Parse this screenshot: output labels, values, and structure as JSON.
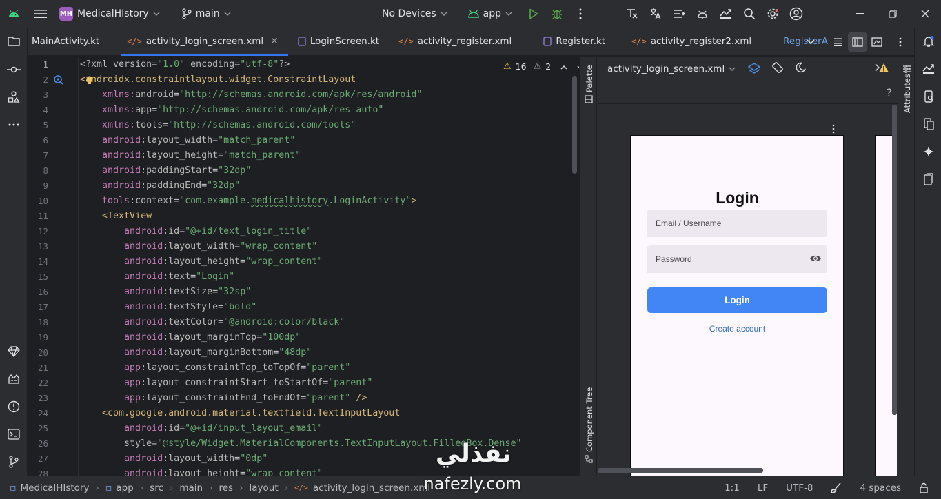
{
  "titlebar": {
    "project_badge": "MH",
    "project_name": "MedicalHIstory",
    "branch": "main",
    "device": "No Devices",
    "run_config": "app"
  },
  "tabs": [
    {
      "label": "MainActivity.kt",
      "active": false
    },
    {
      "label": "activity_login_screen.xml",
      "active": true
    },
    {
      "label": "LoginScreen.kt",
      "active": false
    },
    {
      "label": "activity_register.xml",
      "active": false
    },
    {
      "label": "Register.kt",
      "active": false
    },
    {
      "label": "activity_register2.xml",
      "active": false
    },
    {
      "label": "RegisterA",
      "active": false
    }
  ],
  "inspections": {
    "warnings": "16",
    "weak_warnings": "2"
  },
  "code_lines": [
    [
      [
        "pi",
        "<?xml "
      ],
      [
        "attr",
        "version"
      ],
      [
        "pun",
        "="
      ],
      [
        "str",
        "\"1.0\""
      ],
      [
        "attr",
        " encoding"
      ],
      [
        "pun",
        "="
      ],
      [
        "str",
        "\"utf-8\""
      ],
      [
        "pi",
        "?>"
      ]
    ],
    [
      [
        "tag",
        "<androidx.constraintlayout.widget.ConstraintLayout"
      ]
    ],
    [
      [
        "pun",
        "    "
      ],
      [
        "ns",
        "xmlns:"
      ],
      [
        "attr",
        "android"
      ],
      [
        "pun",
        "="
      ],
      [
        "str",
        "\"http://schemas.android.com/apk/res/android\""
      ]
    ],
    [
      [
        "pun",
        "    "
      ],
      [
        "ns",
        "xmlns:"
      ],
      [
        "attr",
        "app"
      ],
      [
        "pun",
        "="
      ],
      [
        "str",
        "\"http://schemas.android.com/apk/res-auto\""
      ]
    ],
    [
      [
        "pun",
        "    "
      ],
      [
        "ns",
        "xmlns:"
      ],
      [
        "attr",
        "tools"
      ],
      [
        "pun",
        "="
      ],
      [
        "str",
        "\"http://schemas.android.com/tools\""
      ]
    ],
    [
      [
        "pun",
        "    "
      ],
      [
        "ns",
        "android"
      ],
      [
        "attr",
        ":layout_width"
      ],
      [
        "pun",
        "="
      ],
      [
        "str",
        "\"match_parent\""
      ]
    ],
    [
      [
        "pun",
        "    "
      ],
      [
        "ns",
        "android"
      ],
      [
        "attr",
        ":layout_height"
      ],
      [
        "pun",
        "="
      ],
      [
        "str",
        "\"match_parent\""
      ]
    ],
    [
      [
        "pun",
        "    "
      ],
      [
        "ns",
        "android"
      ],
      [
        "attr",
        ":paddingStart"
      ],
      [
        "pun",
        "="
      ],
      [
        "str",
        "\"32dp\""
      ]
    ],
    [
      [
        "pun",
        "    "
      ],
      [
        "ns",
        "android"
      ],
      [
        "attr",
        ":paddingEnd"
      ],
      [
        "pun",
        "="
      ],
      [
        "str",
        "\"32dp\""
      ]
    ],
    [
      [
        "pun",
        "    "
      ],
      [
        "ns",
        "tools"
      ],
      [
        "attr",
        ":context"
      ],
      [
        "pun",
        "="
      ],
      [
        "str",
        "\"com.example."
      ],
      [
        "sq",
        "medicalhistory"
      ],
      [
        "str",
        ".LoginActivity\""
      ],
      [
        "tag",
        ">"
      ]
    ],
    [
      [
        "pun",
        "    "
      ],
      [
        "tag",
        "<TextView"
      ]
    ],
    [
      [
        "pun",
        "        "
      ],
      [
        "ns",
        "android"
      ],
      [
        "attr",
        ":id"
      ],
      [
        "pun",
        "="
      ],
      [
        "str",
        "\"@+id/text_login_title\""
      ]
    ],
    [
      [
        "pun",
        "        "
      ],
      [
        "ns",
        "android"
      ],
      [
        "attr",
        ":layout_width"
      ],
      [
        "pun",
        "="
      ],
      [
        "str",
        "\"wrap_content\""
      ]
    ],
    [
      [
        "pun",
        "        "
      ],
      [
        "ns",
        "android"
      ],
      [
        "attr",
        ":layout_height"
      ],
      [
        "pun",
        "="
      ],
      [
        "str",
        "\"wrap_content\""
      ]
    ],
    [
      [
        "pun",
        "        "
      ],
      [
        "ns",
        "android"
      ],
      [
        "attr",
        ":text"
      ],
      [
        "pun",
        "="
      ],
      [
        "str",
        "\"Login\""
      ]
    ],
    [
      [
        "pun",
        "        "
      ],
      [
        "ns",
        "android"
      ],
      [
        "attr",
        ":textSize"
      ],
      [
        "pun",
        "="
      ],
      [
        "str",
        "\"32sp\""
      ]
    ],
    [
      [
        "pun",
        "        "
      ],
      [
        "ns",
        "android"
      ],
      [
        "attr",
        ":textStyle"
      ],
      [
        "pun",
        "="
      ],
      [
        "str",
        "\"bold\""
      ]
    ],
    [
      [
        "pun",
        "        "
      ],
      [
        "ns",
        "android"
      ],
      [
        "attr",
        ":textColor"
      ],
      [
        "pun",
        "="
      ],
      [
        "str",
        "\"@android:color/black\""
      ]
    ],
    [
      [
        "pun",
        "        "
      ],
      [
        "ns",
        "android"
      ],
      [
        "attr",
        ":layout_marginTop"
      ],
      [
        "pun",
        "="
      ],
      [
        "str",
        "\"100dp\""
      ]
    ],
    [
      [
        "pun",
        "        "
      ],
      [
        "ns",
        "android"
      ],
      [
        "attr",
        ":layout_marginBottom"
      ],
      [
        "pun",
        "="
      ],
      [
        "str",
        "\"48dp\""
      ]
    ],
    [
      [
        "pun",
        "        "
      ],
      [
        "ns",
        "app"
      ],
      [
        "attr",
        ":layout_constraintTop_toTopOf"
      ],
      [
        "pun",
        "="
      ],
      [
        "str",
        "\"parent\""
      ]
    ],
    [
      [
        "pun",
        "        "
      ],
      [
        "ns",
        "app"
      ],
      [
        "attr",
        ":layout_constraintStart_toStartOf"
      ],
      [
        "pun",
        "="
      ],
      [
        "str",
        "\"parent\""
      ]
    ],
    [
      [
        "pun",
        "        "
      ],
      [
        "ns",
        "app"
      ],
      [
        "attr",
        ":layout_constraintEnd_toEndOf"
      ],
      [
        "pun",
        "="
      ],
      [
        "str",
        "\"parent\""
      ],
      [
        "tag",
        " />"
      ]
    ],
    [
      [
        "pun",
        "    "
      ],
      [
        "tag",
        "<com.google.android.material.textfield.TextInputLayout"
      ]
    ],
    [
      [
        "pun",
        "        "
      ],
      [
        "ns",
        "android"
      ],
      [
        "attr",
        ":id"
      ],
      [
        "pun",
        "="
      ],
      [
        "str",
        "\"@+id/input_layout_email\""
      ]
    ],
    [
      [
        "pun",
        "        "
      ],
      [
        "attr",
        "style"
      ],
      [
        "pun",
        "="
      ],
      [
        "str",
        "\"@style/Widget.MaterialComponents.TextInputLayout.FilledBox.Dense\""
      ]
    ],
    [
      [
        "pun",
        "        "
      ],
      [
        "ns",
        "android"
      ],
      [
        "attr",
        ":layout_width"
      ],
      [
        "pun",
        "="
      ],
      [
        "str",
        "\"0dp\""
      ]
    ],
    [
      [
        "pun",
        "        "
      ],
      [
        "ns",
        "android"
      ],
      [
        "attr",
        ":layout_height"
      ],
      [
        "pun",
        "="
      ],
      [
        "str",
        "\"wrap_content\""
      ]
    ]
  ],
  "preview": {
    "palette_label": "Palette",
    "component_tree_label": "Component Tree",
    "attributes_label": "Attributes",
    "file_name": "activity_login_screen.xml",
    "help": "?",
    "login_title": "Login",
    "email_hint": "Email / Username",
    "password_hint": "Password",
    "login_button": "Login",
    "create_account": "Create account"
  },
  "statusbar": {
    "breadcrumb": [
      "MedicalHIstory",
      "app",
      "src",
      "main",
      "res",
      "layout",
      "activity_login_screen.xml"
    ],
    "position": "1:1",
    "line_ending": "LF",
    "encoding": "UTF-8",
    "indent": "4 spaces"
  },
  "watermark": {
    "arabic": "نفذلي",
    "latin": "nafezly.com"
  },
  "colors": {
    "accent": "#3574f0",
    "preview_button": "#4285f4",
    "warning": "#f2c55c"
  }
}
